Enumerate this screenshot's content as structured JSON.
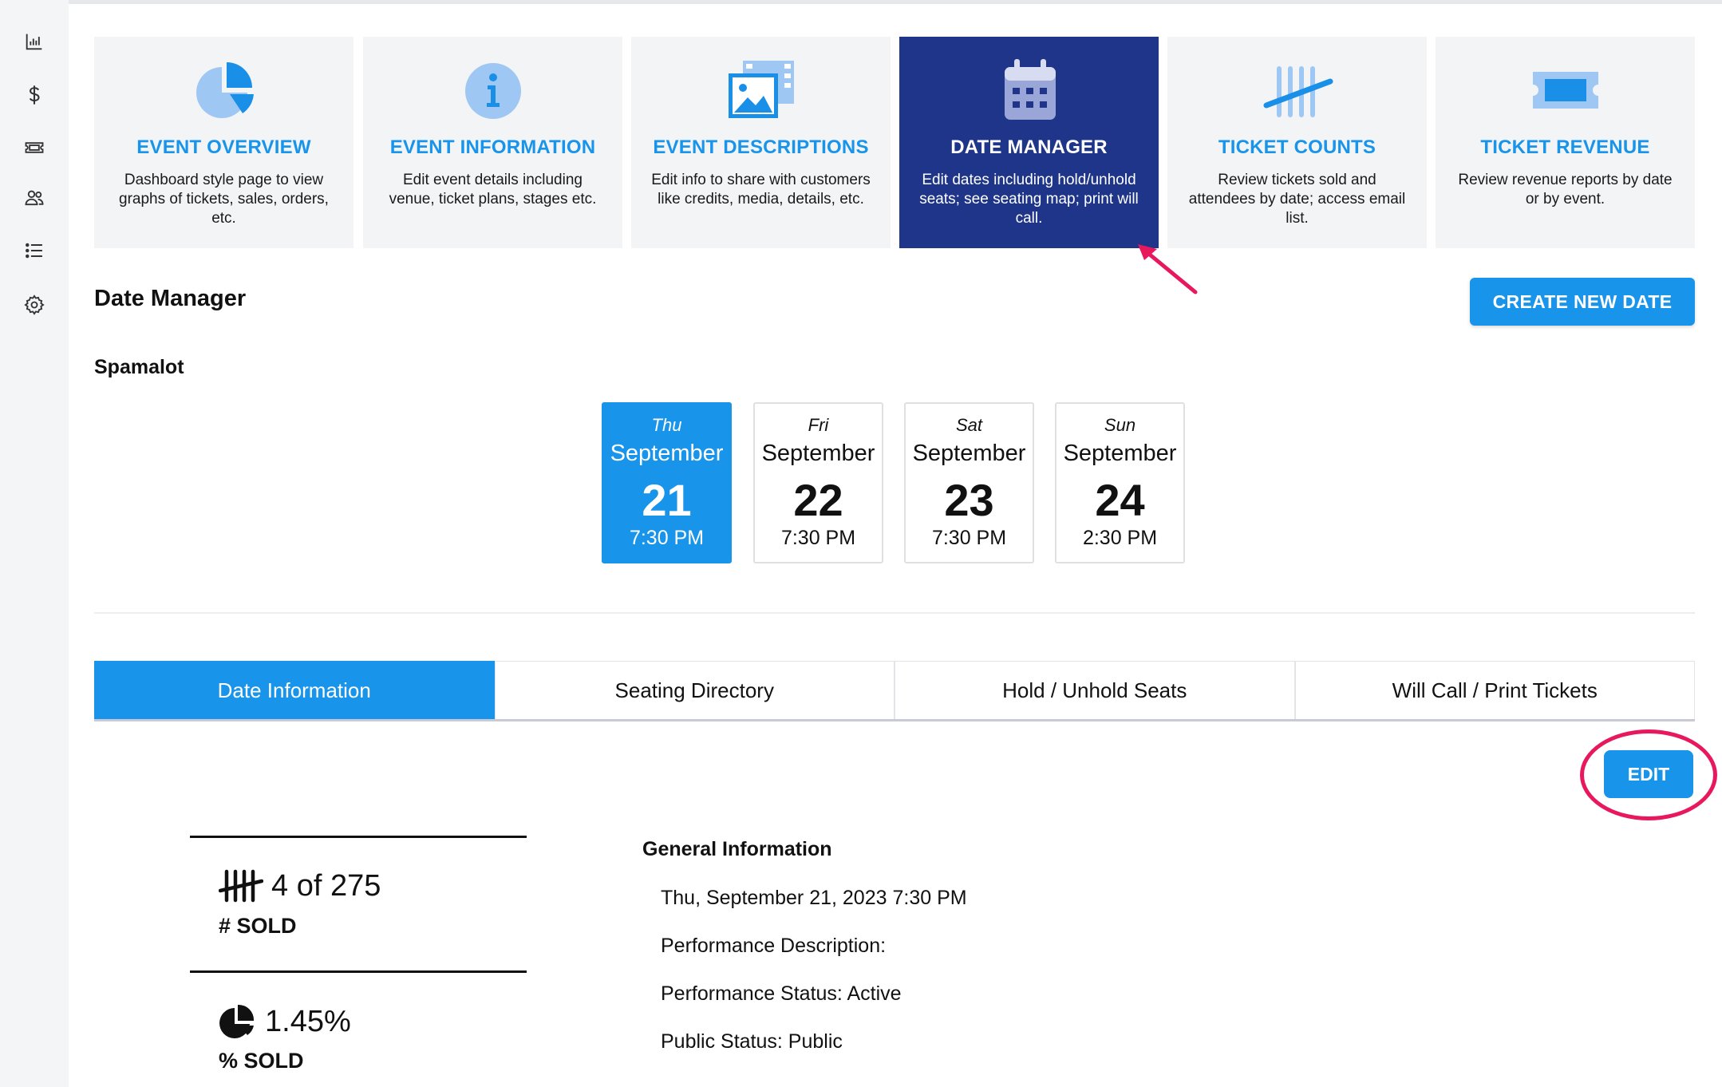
{
  "colors": {
    "accent": "#1894ea",
    "active_card": "#1e3589",
    "highlight": "#e8185d"
  },
  "sidebar": {
    "items": [
      {
        "icon": "bar-chart-icon"
      },
      {
        "icon": "dollar-icon"
      },
      {
        "icon": "ticket-icon"
      },
      {
        "icon": "users-icon"
      },
      {
        "icon": "list-icon"
      },
      {
        "icon": "gear-icon"
      }
    ]
  },
  "cards": [
    {
      "title": "EVENT OVERVIEW",
      "desc": "Dashboard style page to view graphs of tickets, sales, orders, etc.",
      "icon": "pie-chart-icon"
    },
    {
      "title": "EVENT INFORMATION",
      "desc": "Edit event details including venue, ticket plans, stages etc.",
      "icon": "info-icon"
    },
    {
      "title": "EVENT DESCRIPTIONS",
      "desc": "Edit info to share with customers like credits, media, details, etc.",
      "icon": "media-icon"
    },
    {
      "title": "DATE MANAGER",
      "desc": "Edit dates including hold/unhold seats; see seating map; print will call.",
      "icon": "calendar-icon",
      "active": true
    },
    {
      "title": "TICKET COUNTS",
      "desc": "Review tickets sold and attendees by date; access email list.",
      "icon": "tally-icon"
    },
    {
      "title": "TICKET REVENUE",
      "desc": "Review revenue reports by date or by event.",
      "icon": "ticket-icon"
    }
  ],
  "page": {
    "title": "Date Manager",
    "create_button": "CREATE NEW DATE",
    "event_name": "Spamalot"
  },
  "dates": [
    {
      "dow": "Thu",
      "month": "September",
      "day": "21",
      "time": "7:30 PM",
      "selected": true
    },
    {
      "dow": "Fri",
      "month": "September",
      "day": "22",
      "time": "7:30 PM"
    },
    {
      "dow": "Sat",
      "month": "September",
      "day": "23",
      "time": "7:30 PM"
    },
    {
      "dow": "Sun",
      "month": "September",
      "day": "24",
      "time": "2:30 PM"
    }
  ],
  "tabs": [
    "Date Information",
    "Seating Directory",
    "Hold / Unhold Seats",
    "Will Call / Print Tickets"
  ],
  "edit_button": "EDIT",
  "stats": {
    "sold_value": "4 of 275",
    "sold_label": "# SOLD",
    "percent_value": "1.45%",
    "percent_label": "% SOLD"
  },
  "general_info": {
    "title": "General Information",
    "lines": [
      "Thu, September 21, 2023 7:30 PM",
      "Performance Description:",
      "Performance Status: Active",
      "Public Status: Public"
    ]
  }
}
